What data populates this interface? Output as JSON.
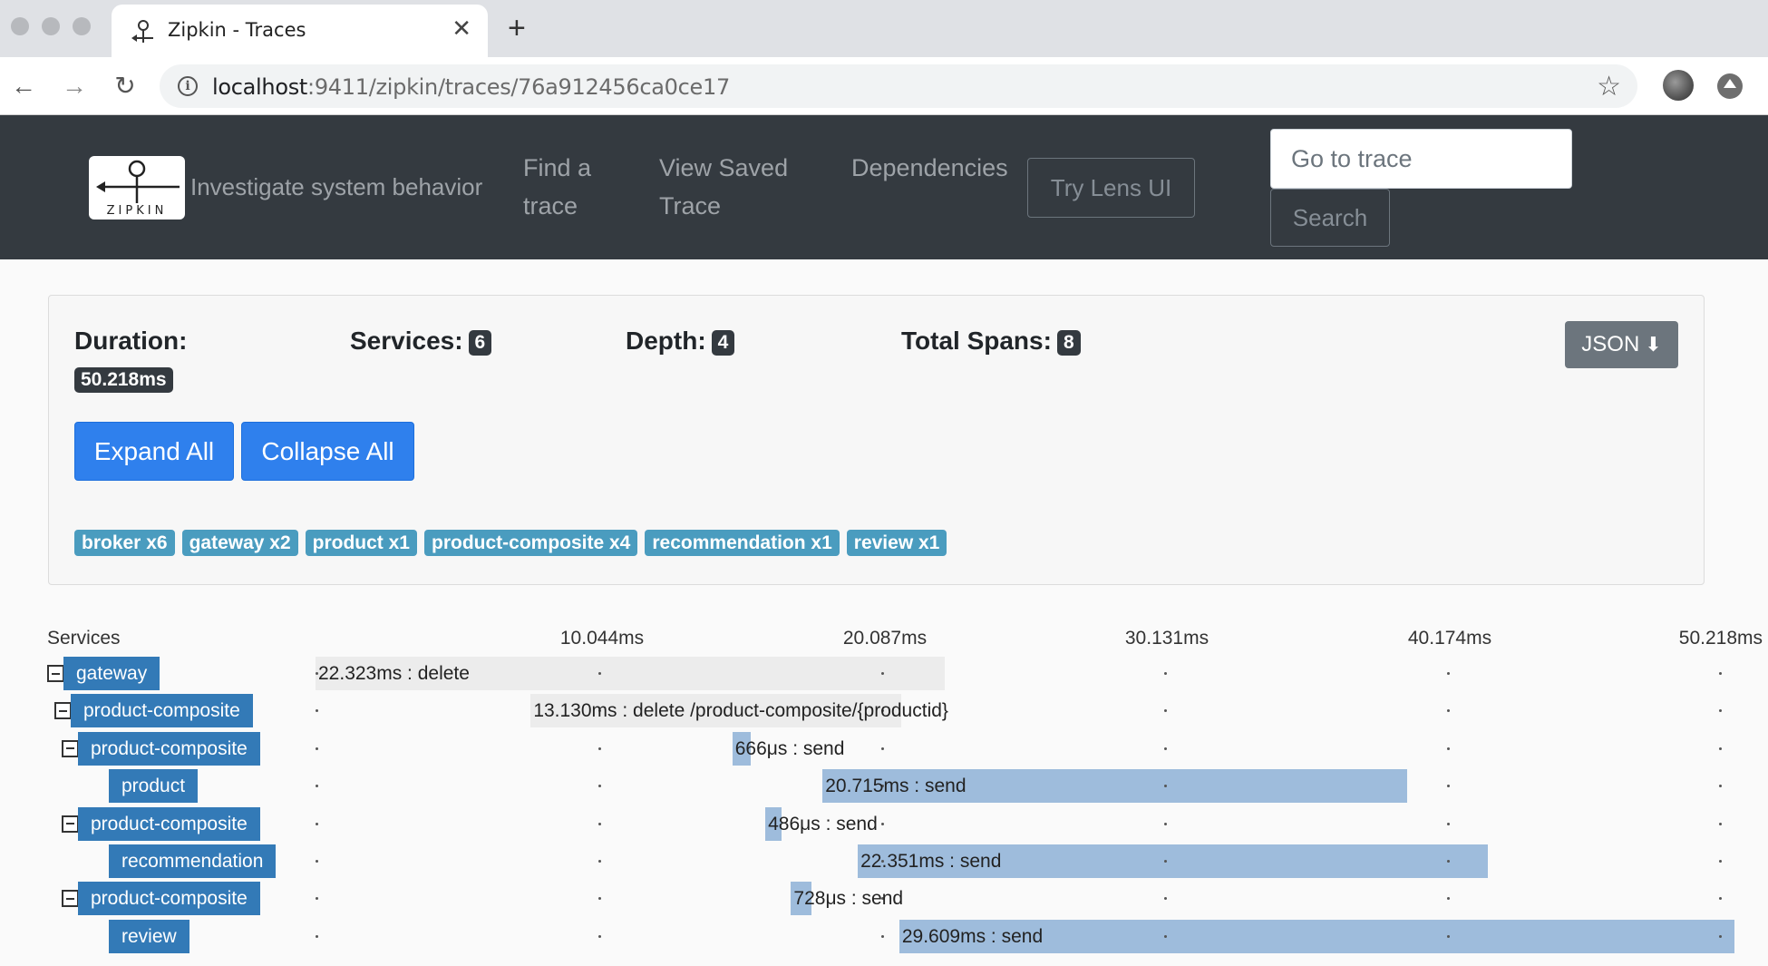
{
  "browser": {
    "tab_title": "Zipkin - Traces",
    "url_host": "localhost",
    "url_path": ":9411/zipkin/traces/76a912456ca0ce17"
  },
  "nav": {
    "logo_text": "ZIPKIN",
    "tagline": "Investigate system behavior",
    "find_trace": [
      "Find a",
      "trace"
    ],
    "view_saved": [
      "View Saved",
      "Trace"
    ],
    "dependencies": "Dependencies",
    "try_lens": "Try Lens UI",
    "goto_placeholder": "Go to trace",
    "search": "Search"
  },
  "summary": {
    "duration_label": "Duration:",
    "duration_value": "50.218ms",
    "services_label": "Services:",
    "services_value": "6",
    "depth_label": "Depth:",
    "depth_value": "4",
    "spans_label": "Total Spans:",
    "spans_value": "8",
    "json_label": "JSON",
    "expand_all": "Expand All",
    "collapse_all": "Collapse All",
    "service_badges": [
      "broker x6",
      "gateway x2",
      "product x1",
      "product-composite x4",
      "recommendation x1",
      "review x1"
    ]
  },
  "timeline": {
    "services_header": "Services",
    "ticks": [
      "10.044ms",
      "20.087ms",
      "30.131ms",
      "40.174ms",
      "50.218ms"
    ],
    "total_ms": 50.218,
    "rows": [
      {
        "service": "gateway",
        "depth": 0,
        "collapsible": true,
        "start_ms": 0.0,
        "duration_ms": 22.323,
        "label": "22.323ms : delete"
      },
      {
        "service": "product-composite",
        "depth": 1,
        "collapsible": true,
        "start_ms": 7.63,
        "duration_ms": 13.13,
        "label": "13.130ms : delete /product-composite/{productid}"
      },
      {
        "service": "product-composite",
        "depth": 2,
        "collapsible": true,
        "start_ms": 14.78,
        "duration_ms": 0.666,
        "label": "666μs : send"
      },
      {
        "service": "product",
        "depth": 3,
        "collapsible": false,
        "start_ms": 17.98,
        "duration_ms": 20.715,
        "label": "20.715ms : send"
      },
      {
        "service": "product-composite",
        "depth": 2,
        "collapsible": true,
        "start_ms": 15.95,
        "duration_ms": 0.486,
        "label": "486μs : send"
      },
      {
        "service": "recommendation",
        "depth": 3,
        "collapsible": false,
        "start_ms": 19.23,
        "duration_ms": 22.351,
        "label": "22.351ms : send"
      },
      {
        "service": "product-composite",
        "depth": 2,
        "collapsible": true,
        "start_ms": 16.86,
        "duration_ms": 0.728,
        "label": "728μs : send"
      },
      {
        "service": "review",
        "depth": 3,
        "collapsible": false,
        "start_ms": 20.7,
        "duration_ms": 29.609,
        "label": "29.609ms : send"
      }
    ]
  },
  "colors": {
    "navbar": "#343a40",
    "primary": "#2f80ed",
    "service_label": "#337ab7",
    "service_badge": "#4a9cbf",
    "span_child": "#9ebcdc",
    "span_parent": "#ececec"
  }
}
